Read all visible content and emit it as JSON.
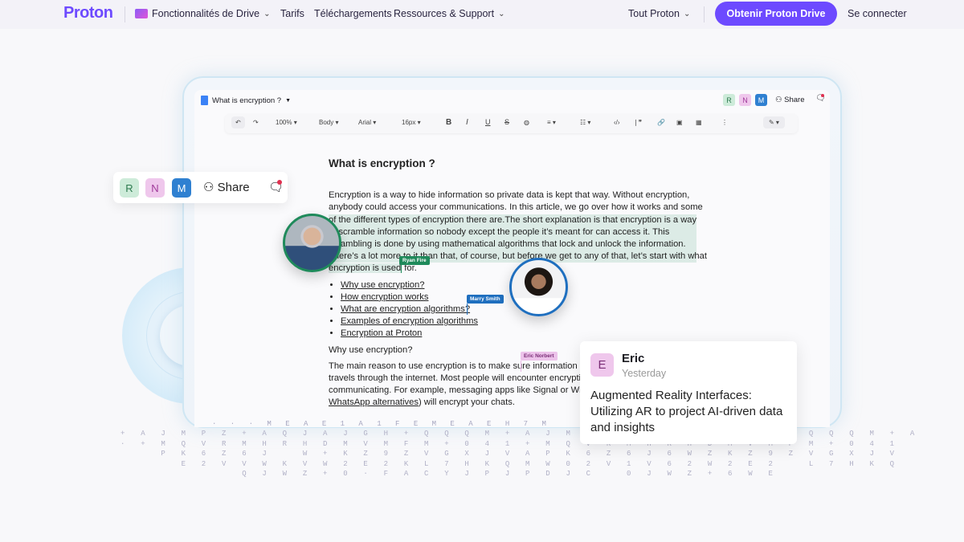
{
  "nav": {
    "logo": "Proton",
    "drive_features": "Fonctionnalités de Drive",
    "pricing": "Tarifs",
    "downloads": "Téléchargements",
    "resources": "Ressources & Support",
    "all_proton": "Tout Proton",
    "cta": "Obtenir Proton Drive",
    "login": "Se connecter"
  },
  "editor": {
    "title": "What is encryption ?",
    "collaborators": [
      "R",
      "N",
      "M"
    ],
    "share": "Share",
    "toolbar": {
      "zoom": "100%",
      "style": "Body",
      "font": "Arial",
      "size": "16px"
    },
    "heading": "What is encryption ?",
    "para1": [
      "Encryption is a way to hide information so private data is kept that way. Without encryption,",
      "anybody could access your communications. In this article, we go over how it works and some",
      "of the different types of encryption there are.The short explanation is that encryption is a way",
      "to scramble information so nobody except the people it’s meant for can access it. This",
      "scrambling is done by using mathematical algorithms that lock and unlock the information.",
      "There’s a lot more to it than that, of course, but before we get to any of that, let’s start with what",
      "encryption is used",
      "for."
    ],
    "links": [
      "Why use encryption?",
      "How encryption works",
      "What are encryption algorithms?",
      "Examples of encryption algorithms",
      "Encryption at Proton"
    ],
    "subheading": "Why use encryption?",
    "para2": [
      "The main reason to use encryption is to make sure information stays private as it",
      "travels through the internet. Most people will encounter encryption daily when",
      "communicating. For example, messaging apps like Signal or Wire (see our"
    ],
    "para2_last_link": "WhatsApp alternatives",
    "para2_last_rest": ") will encrypt your chats.",
    "cursors": {
      "ryan": "Ryan Fire",
      "marry": "Marry Smith",
      "eric": "Eric Norbert"
    }
  },
  "share_pill": {
    "avatars": [
      "R",
      "N",
      "M"
    ],
    "label": "Share"
  },
  "comment": {
    "initial": "E",
    "author": "Eric",
    "time": "Yesterday",
    "text": "Augmented Reality Interfaces: Utilizing AR to project AI-driven data and insights"
  },
  "matrix": [
    "          · · · M E A E 1 A 1 F E M E A E H 7 M",
    "+ A J M P Z + A Q J A J G H + Q Q Q M + A J M P Z + A Q J A J G Q + Q Q Q M + A",
    "· + M Q V R M H R H D M V M F M + 0 4 1 + M Q V R M H R H D M V M F M + 0 4 1",
    "    P K 6 Z 6 J   W + K Z 9 Z V G X J V A P K 6 Z 6 J 6 W Z K Z 9 Z V G X J V",
    "      E 2 V V W K V W 2 E 2 K L 7 H K Q M W 0 2 V 1 V 6 2 W 2 E 2   L 7 H K Q",
    "            Q J W Z + 0 · F A C Y J P J P D J C   0 J W Z + 6 W E"
  ],
  "colors": {
    "brand": "#6d4aff",
    "ryan": "#1f8a5b",
    "marry": "#1f6fbf",
    "eric": "#e9b8e6"
  }
}
